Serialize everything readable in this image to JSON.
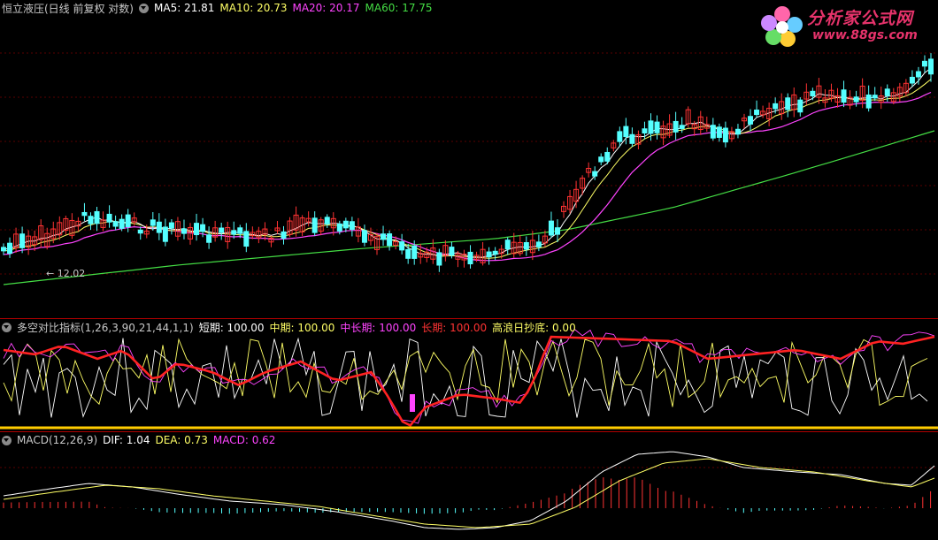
{
  "main_panel": {
    "title": "恒立液压(日线 前复权 对数)",
    "ma5": "MA5: 21.81",
    "ma10": "MA10: 20.73",
    "ma20": "MA20: 20.17",
    "ma60": "MA60: 17.75",
    "min_price_label": "12.02",
    "colors": {
      "ma5": "#ffffff",
      "ma10": "#ffff66",
      "ma20": "#ff44ff",
      "ma60": "#44dd44",
      "up": "#ff3333",
      "down": "#55ffff"
    }
  },
  "watermark": {
    "title": "分析家公式网",
    "url": "www.88gs.com",
    "icon": "flower-logo-icon"
  },
  "indicator_panel": {
    "title": "多空对比指标(1,26,3,90,21,44,1,1)",
    "short": "短期: 100.00",
    "mid": "中期: 100.00",
    "midlong": "中长期: 100.00",
    "long": "长期: 100.00",
    "bottom": "高浪日抄底: 0.00",
    "colors": {
      "short": "#ffffff",
      "mid": "#ffff66",
      "midlong": "#ff44ff",
      "long": "#ff2222",
      "base": "#ffcc00"
    }
  },
  "macd_panel": {
    "title": "MACD(12,26,9)",
    "dif": "DIF: 1.04",
    "dea": "DEA: 0.73",
    "macd": "MACD: 0.62",
    "colors": {
      "dif": "#ffffff",
      "dea": "#ffff66",
      "macd": "#ff44ff"
    }
  }
}
